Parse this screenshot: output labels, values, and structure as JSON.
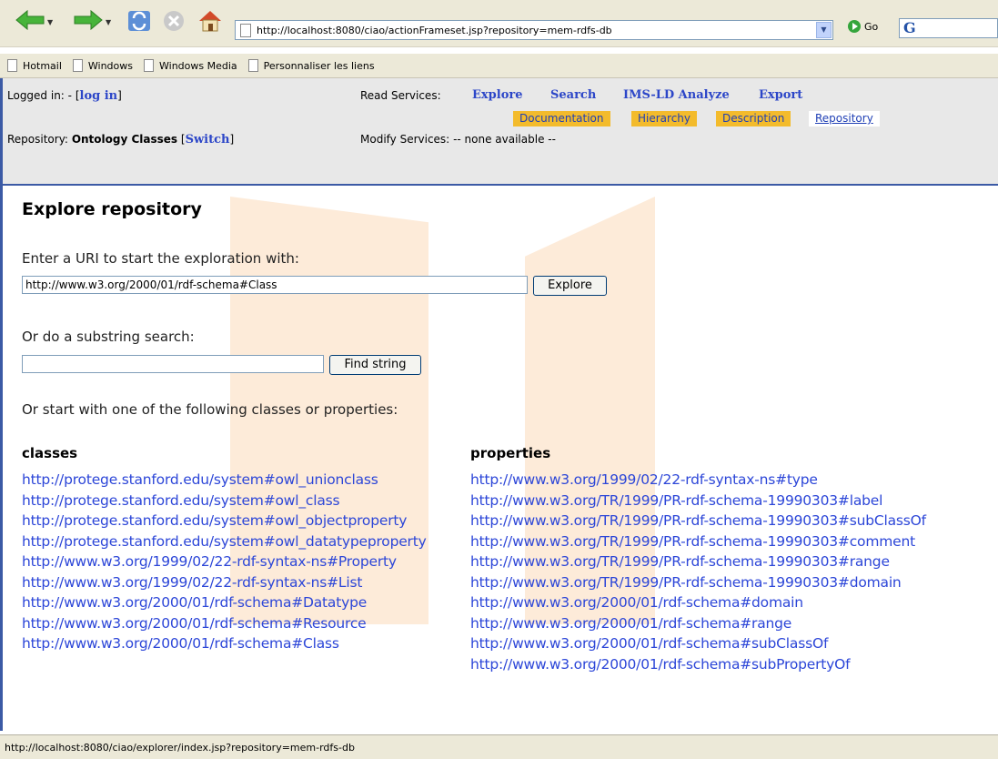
{
  "browser": {
    "address_url": "http://localhost:8080/ciao/actionFrameset.jsp?repository=mem-rdfs-db",
    "go_label": "Go",
    "search_logo": "G"
  },
  "links_bar": [
    "Hotmail",
    "Windows",
    "Windows Media",
    "Personnaliser les liens"
  ],
  "header": {
    "logged_in_label": "Logged in: -",
    "log_in_link": "log in",
    "repository_label": "Repository:",
    "repository_name": "Ontology Classes",
    "switch_link": "Switch",
    "read_services_label": "Read Services:",
    "read_services": [
      "Explore",
      "Search",
      "IMS-LD Analyze",
      "Export"
    ],
    "tabs": [
      "Documentation",
      "Hierarchy",
      "Description",
      "Repository"
    ],
    "modify_services_label": "Modify Services:",
    "modify_services_value": "-- none available --"
  },
  "main": {
    "title": "Explore repository",
    "uri_prompt": "Enter a URI to start the exploration with:",
    "uri_value": "http://www.w3.org/2000/01/rdf-schema#Class",
    "explore_button": "Explore",
    "substring_prompt": "Or do a substring search:",
    "substring_value": "",
    "find_button": "Find string",
    "start_prompt": "Or start with one of the following classes or properties:",
    "classes_heading": "classes",
    "classes": [
      "http://protege.stanford.edu/system#owl_unionclass",
      "http://protege.stanford.edu/system#owl_class",
      "http://protege.stanford.edu/system#owl_objectproperty",
      "http://protege.stanford.edu/system#owl_datatypeproperty",
      "http://www.w3.org/1999/02/22-rdf-syntax-ns#Property",
      "http://www.w3.org/1999/02/22-rdf-syntax-ns#List",
      "http://www.w3.org/2000/01/rdf-schema#Datatype",
      "http://www.w3.org/2000/01/rdf-schema#Resource",
      "http://www.w3.org/2000/01/rdf-schema#Class"
    ],
    "properties_heading": "properties",
    "properties": [
      "http://www.w3.org/1999/02/22-rdf-syntax-ns#type",
      "http://www.w3.org/TR/1999/PR-rdf-schema-19990303#label",
      "http://www.w3.org/TR/1999/PR-rdf-schema-19990303#subClassOf",
      "http://www.w3.org/TR/1999/PR-rdf-schema-19990303#comment",
      "http://www.w3.org/TR/1999/PR-rdf-schema-19990303#range",
      "http://www.w3.org/TR/1999/PR-rdf-schema-19990303#domain",
      "http://www.w3.org/2000/01/rdf-schema#domain",
      "http://www.w3.org/2000/01/rdf-schema#range",
      "http://www.w3.org/2000/01/rdf-schema#subClassOf",
      "http://www.w3.org/2000/01/rdf-schema#subPropertyOf"
    ]
  },
  "status_bar": "http://localhost:8080/ciao/explorer/index.jsp?repository=mem-rdfs-db",
  "colors": {
    "link": "#2c46d8",
    "active_tab": "#f3bb2c",
    "frame_border": "#3b5aa5",
    "decoration": "#fdebd9"
  },
  "icons": [
    "back-arrow-icon",
    "forward-arrow-icon",
    "refresh-icon",
    "stop-icon",
    "home-icon",
    "page-icon",
    "go-icon"
  ]
}
